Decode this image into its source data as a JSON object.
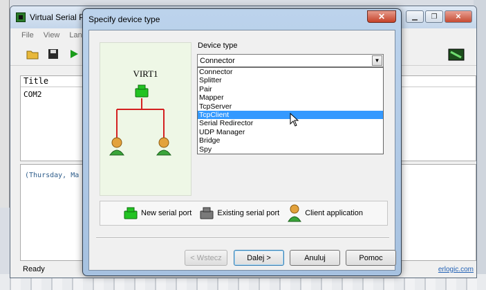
{
  "app": {
    "title": "Virtual Serial Po",
    "menu": [
      "File",
      "View",
      "Lan"
    ],
    "list_header": "Title",
    "list_row": "COM2",
    "log_line": "(Thursday, Ma",
    "status": "Ready",
    "link": "erlogic.com"
  },
  "dialog": {
    "title": "Specify device type",
    "diagram_label": "VIRT1",
    "device_type_label": "Device type",
    "selected_value": "Connector",
    "options": [
      "Connector",
      "Splitter",
      "Pair",
      "Mapper",
      "TcpServer",
      "TcpClient",
      "Serial Redirector",
      "UDP Manager",
      "Bridge",
      "Spy"
    ],
    "highlighted_option": "TcpClient",
    "legend": {
      "new_port": "New serial port",
      "existing_port": "Existing serial port",
      "client_app": "Client application"
    },
    "buttons": {
      "back": "< Wstecz",
      "next": "Dalej >",
      "cancel": "Anuluj",
      "help": "Pomoc"
    },
    "colors": {
      "new_port_green": "#22c322",
      "existing_port_gray": "#7a7a7a",
      "line_red": "#d42020",
      "highlight_blue": "#3399ff"
    }
  }
}
